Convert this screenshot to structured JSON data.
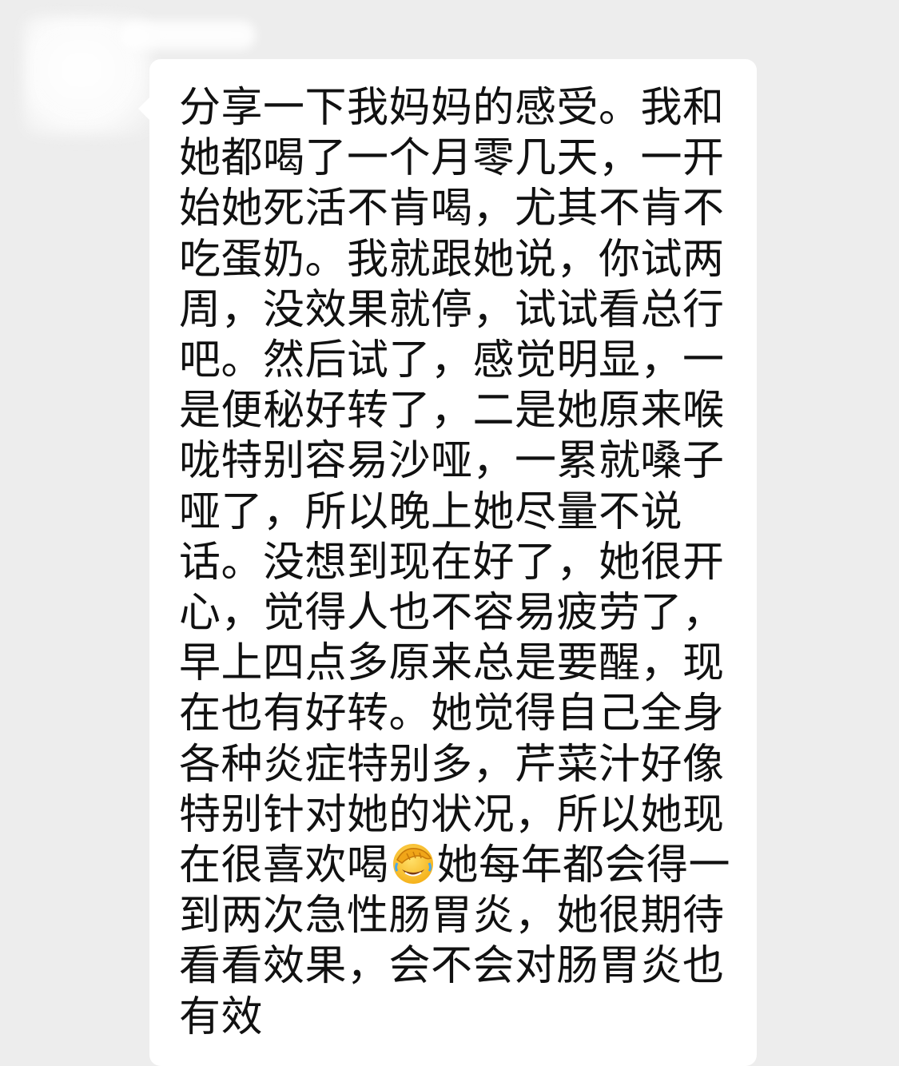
{
  "chat": {
    "sender_name": "",
    "message_lines": [
      "分享一下我妈妈的感受。我和",
      "她都喝了一个月零几天，一开",
      "始她死活不肯喝，尤其不肯不",
      "吃蛋奶。我就跟她说，你试两",
      "周，没效果就停，试试看总行",
      "吧。然后试了，感觉明显，一",
      "是便秘好转了，二是她原来喉",
      "咙特别容易沙哑，一累就嗓子",
      "哑了，所以晚上她尽量不说",
      "话。没想到现在好了，她很开",
      "心，觉得人也不容易疲劳了，",
      "早上四点多原来总是要醒，现",
      "在也有好转。她觉得自己全身",
      "各种炎症特别多，芹菜汁好像",
      "特别针对她的状况，所以她现"
    ],
    "emoji_line": {
      "before": "在很喜欢喝",
      "emoji_icon": "face-palm-emoji-icon",
      "after": "她每年都会得一"
    },
    "message_lines_end": [
      "到两次急性肠胃炎，她很期待",
      "看看效果，会不会对肠胃炎也",
      "有效"
    ]
  },
  "colors": {
    "background": "#ededed",
    "bubble": "#ffffff",
    "text": "#111111"
  }
}
